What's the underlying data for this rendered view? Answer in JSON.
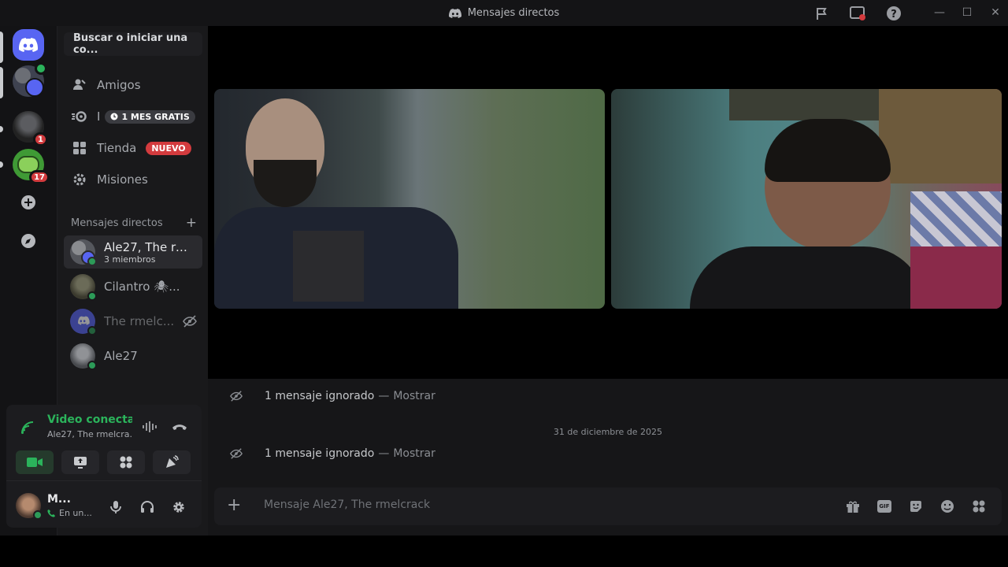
{
  "window": {
    "title": "Mensajes directos"
  },
  "rail": {
    "servers": [
      {
        "name": "home",
        "badge": ""
      },
      {
        "name": "group-dm",
        "badge": ""
      },
      {
        "name": "server-1",
        "badge": "1"
      },
      {
        "name": "server-2",
        "badge": "17"
      }
    ]
  },
  "sidebar": {
    "search_label": "Buscar o iniciar una co...",
    "nav": [
      {
        "label": "Amigos",
        "tag": ""
      },
      {
        "label": "I",
        "tag": "1 MES GRATIS"
      },
      {
        "label": "Tienda",
        "tag": "NUEVO"
      },
      {
        "label": "Misiones",
        "tag": ""
      }
    ],
    "dm_header": "Mensajes directos",
    "dms": [
      {
        "name": "Ale27, The rm...",
        "sub": "3 miembros"
      },
      {
        "name": "Cilantro 🕷...",
        "sub": ""
      },
      {
        "name": "The rmelc...",
        "sub": ""
      },
      {
        "name": "Ale27",
        "sub": ""
      }
    ]
  },
  "voice": {
    "status": "Video conectac",
    "channel": "Ale27, The rmelcra..."
  },
  "user": {
    "name": "M...",
    "status": "En un..."
  },
  "chat": {
    "ignored_1": "1 mensaje ignorado",
    "ignored_sep": "—",
    "show": "Mostrar",
    "date_divider": "31 de diciembre de 2025",
    "ignored_2": "1 mensaje ignorado",
    "composer_placeholder": "Mensaje Ale27, The rmelcrack",
    "gif_label": "GIF"
  },
  "colors": {
    "accent": "#5865f2",
    "online": "#2c9b58",
    "badge": "#d33b3e",
    "voice_green": "#2bb35b"
  }
}
